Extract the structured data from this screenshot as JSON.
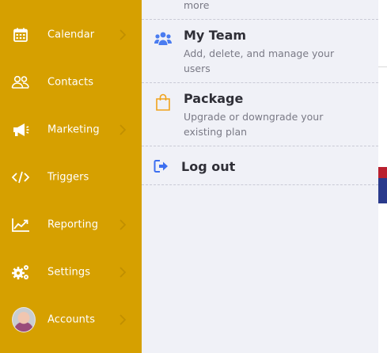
{
  "sidebar": {
    "items": [
      {
        "label": "Calendar",
        "icon": "calendar-icon",
        "chevron": true
      },
      {
        "label": "Contacts",
        "icon": "contacts-icon",
        "chevron": false
      },
      {
        "label": "Marketing",
        "icon": "megaphone-icon",
        "chevron": true
      },
      {
        "label": "Triggers",
        "icon": "code-icon",
        "chevron": false
      },
      {
        "label": "Reporting",
        "icon": "chart-line-icon",
        "chevron": true
      },
      {
        "label": "Settings",
        "icon": "gears-icon",
        "chevron": true
      },
      {
        "label": "Accounts",
        "icon": "avatar",
        "chevron": true
      }
    ]
  },
  "menu": {
    "partial_text": "more",
    "my_team": {
      "title": "My Team",
      "desc": "Add, delete, and manage your users",
      "icon": "users-icon"
    },
    "package": {
      "title": "Package",
      "desc": "Upgrade or downgrade your existing plan",
      "icon": "shopping-bag-icon"
    },
    "logout": {
      "title": "Log out",
      "icon": "logout-icon"
    }
  },
  "colors": {
    "sidebar_bg": "#d6a000",
    "panel_bg": "#f0f1f7",
    "team_icon": "#4a7cf0",
    "package_icon": "#f0a31c",
    "logout_icon": "#3d6ff0"
  }
}
